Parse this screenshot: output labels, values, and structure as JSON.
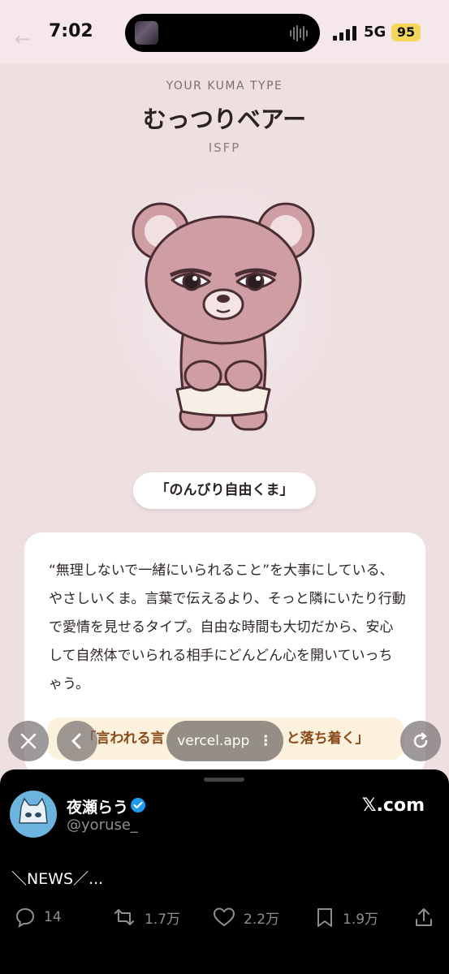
{
  "status_bar": {
    "time": "7:02",
    "network": "5G",
    "battery": "95"
  },
  "result": {
    "eyebrow": "YOUR KUMA TYPE",
    "type_name": "むっつりベアー",
    "type_code": "ISFP",
    "nickname": "「のんびり自由くま」",
    "description": "“無理しないで一緒にいられること”を大事にしている、やさしいくま。言葉で伝えるより、そっと隣にいたり行動で愛情を見せるタイプ。自由な時間も大切だから、安心して自然体でいられる相手にどんどん心を開いていっちゃう。",
    "quote_left": "「言われる言",
    "quote_right": "と落ち着く」"
  },
  "browser": {
    "url": "vercel.app",
    "more_glyph": "⋮"
  },
  "tweet": {
    "author": "夜瀬らう",
    "handle": "@yoruse_",
    "brand": "𝕏.com",
    "text": "＼NEWS／...",
    "replies": "14",
    "reposts": "1.7万",
    "likes": "2.2万",
    "bookmarks": "1.9万"
  },
  "colors": {
    "page_bg": "#eedfe1",
    "bear_fill": "#cf9da4",
    "quote_text": "#8a4a1a",
    "verified": "#1d9bf0"
  },
  "icons": [
    "back-arrow-icon",
    "signal-icon",
    "wave-icon",
    "close-icon",
    "chevron-left-icon",
    "more-icon",
    "reload-icon",
    "verified-icon",
    "reply-icon",
    "repost-icon",
    "like-icon",
    "bookmark-icon",
    "share-icon"
  ]
}
